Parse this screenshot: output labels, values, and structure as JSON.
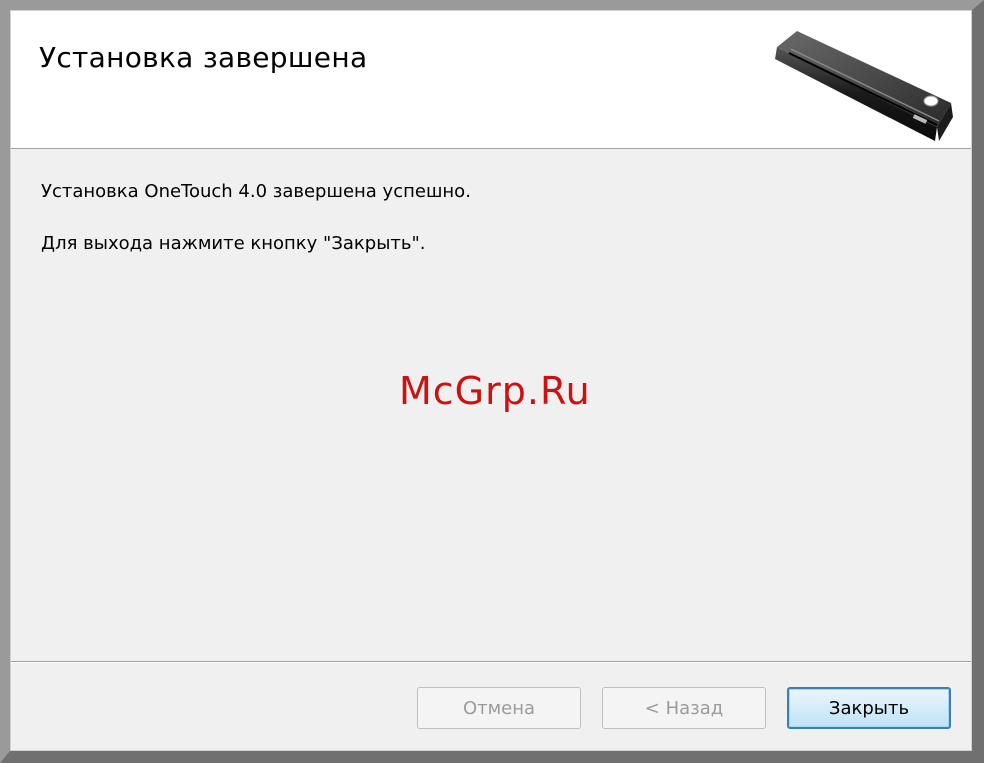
{
  "header": {
    "title": "Установка завершена",
    "image_icon": "scanner-image"
  },
  "body": {
    "line1": "Установка OneTouch 4.0 завершена успешно.",
    "line2": "Для выхода нажмите кнопку \"Закрыть\"."
  },
  "watermark": "McGrp.Ru",
  "buttons": {
    "cancel": "Отмена",
    "back": "< Назад",
    "close": "Закрыть"
  },
  "colors": {
    "header_bg": "#ffffff",
    "dialog_bg": "#f0f0f0",
    "watermark": "#cc1111",
    "default_button_border": "#3c7fb1"
  }
}
